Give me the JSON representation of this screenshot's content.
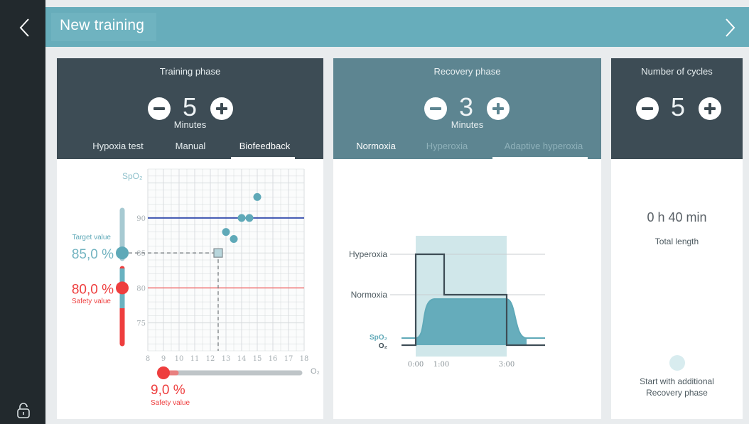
{
  "header": {
    "title": "New training"
  },
  "training": {
    "title": "Training phase",
    "value": "5",
    "unit": "Minutes",
    "tabs": [
      "Hypoxia test",
      "Manual",
      "Biofeedback"
    ],
    "active_tab": "Biofeedback",
    "chart": {
      "y_label": "SpO₂",
      "x_label": "O₂",
      "y_ticks": [
        "90",
        "85",
        "80",
        "75"
      ],
      "x_ticks": [
        "8",
        "9",
        "10",
        "11",
        "12",
        "13",
        "14",
        "15",
        "16",
        "17",
        "18"
      ],
      "target_label": "Target value",
      "target_value": "85,0 %",
      "safety_value": "80,0 %",
      "safety_label": "Safety value",
      "o2_safety_value": "9,0 %",
      "o2_safety_label": "Safety value"
    }
  },
  "recovery": {
    "title": "Recovery phase",
    "value": "3",
    "unit": "Minutes",
    "tabs": [
      "Normoxia",
      "Hyperoxia",
      "Adaptive hyperoxia"
    ],
    "active_tab": "Adaptive hyperoxia",
    "chart": {
      "level_hyper": "Hyperoxia",
      "level_normo": "Normoxia",
      "legend_spo2": "SpO₂",
      "legend_o2": "O₂",
      "x_ticks": [
        "0:00",
        "1:00",
        "3:00"
      ]
    }
  },
  "cycles": {
    "title": "Number of cycles",
    "value": "5",
    "total_value": "0 h 40 min",
    "total_label": "Total length",
    "extra_label_line1": "Start with additional",
    "extra_label_line2": "Recovery phase"
  },
  "chart_data": [
    {
      "type": "scatter",
      "title": "",
      "xlabel": "O₂",
      "ylabel": "SpO₂",
      "xlim": [
        8,
        18
      ],
      "ylim": [
        71,
        97
      ],
      "series": [
        {
          "x": [
            13.0,
            13.5,
            14.0,
            14.5,
            15.0
          ],
          "y": [
            88.0,
            87.0,
            90.0,
            90.0,
            93.0
          ]
        }
      ],
      "target_point": {
        "x": 12.5,
        "y": 85.0
      },
      "reference_lines": [
        {
          "y": 90,
          "color": "#3d54b0"
        },
        {
          "y": 80,
          "color": "#f07070"
        }
      ],
      "grid": true
    },
    {
      "type": "line",
      "title": "",
      "x_ticks": [
        "0:00",
        "1:00",
        "3:00"
      ],
      "levels": [
        "Hyperoxia",
        "Normoxia"
      ],
      "series": [
        {
          "name": "SpO₂"
        },
        {
          "name": "O₂"
        }
      ]
    }
  ],
  "colors": {
    "sidebar": "#22292d",
    "header": "#67adbb",
    "panel_dark": "#3d4c55",
    "panel_teal": "#5d8591",
    "accent_teal": "#5fa9b8",
    "safety_red": "#ee3e3e",
    "target_blue": "#3d54b0"
  },
  "icons": {
    "back": "chevron-left-icon",
    "next": "chevron-right-icon",
    "lock": "lock-icon",
    "minus": "minus-icon",
    "plus": "plus-icon"
  }
}
